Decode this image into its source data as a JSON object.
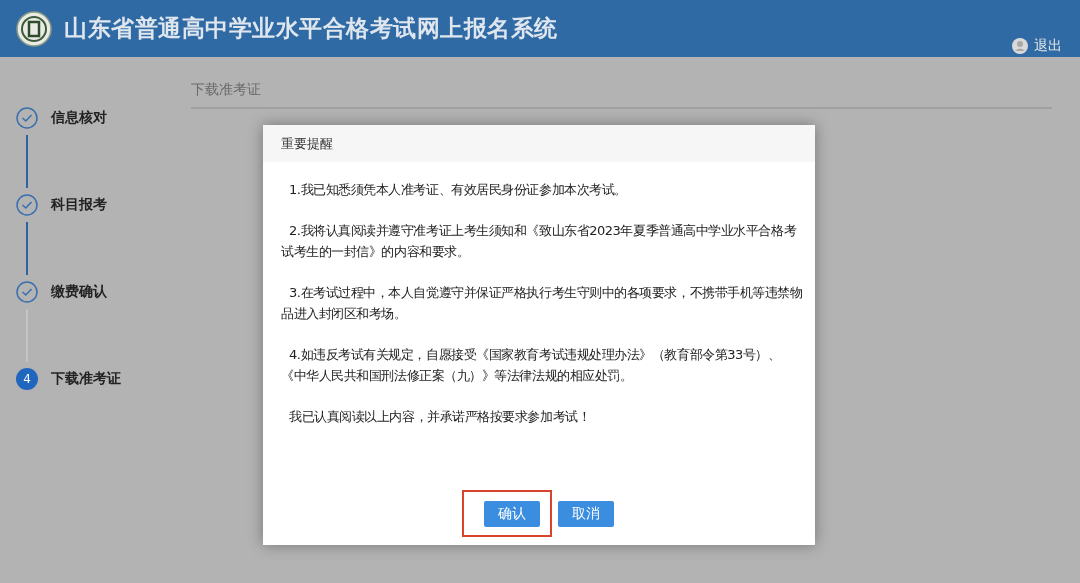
{
  "header": {
    "title": "山东省普通高中学业水平合格考试网上报名系统",
    "logout": "退出"
  },
  "steps": [
    {
      "label": "信息核对",
      "completed": true
    },
    {
      "label": "科目报考",
      "completed": true
    },
    {
      "label": "缴费确认",
      "completed": true
    },
    {
      "number": "4",
      "label": "下载准考证",
      "completed": false
    }
  ],
  "content": {
    "title": "下载准考证"
  },
  "dialog": {
    "title": "重要提醒",
    "paragraphs": [
      "1.我已知悉须凭本人准考证、有效居民身份证参加本次考试。",
      "2.我将认真阅读并遵守准考证上考生须知和《致山东省2023年夏季普通高中学业水平合格考试考生的一封信》的内容和要求。",
      "3.在考试过程中，本人自觉遵守并保证严格执行考生守则中的各项要求，不携带手机等违禁物品进入封闭区和考场。",
      "4.如违反考试有关规定，自愿接受《国家教育考试违规处理办法》（教育部令第33号）、《中华人民共和国刑法修正案（九）》等法律法规的相应处罚。",
      "我已认真阅读以上内容，并承诺严格按要求参加考试！"
    ],
    "buttons": [
      {
        "label": "确认",
        "highlighted": true
      },
      {
        "label": "取消",
        "highlighted": false
      }
    ]
  }
}
